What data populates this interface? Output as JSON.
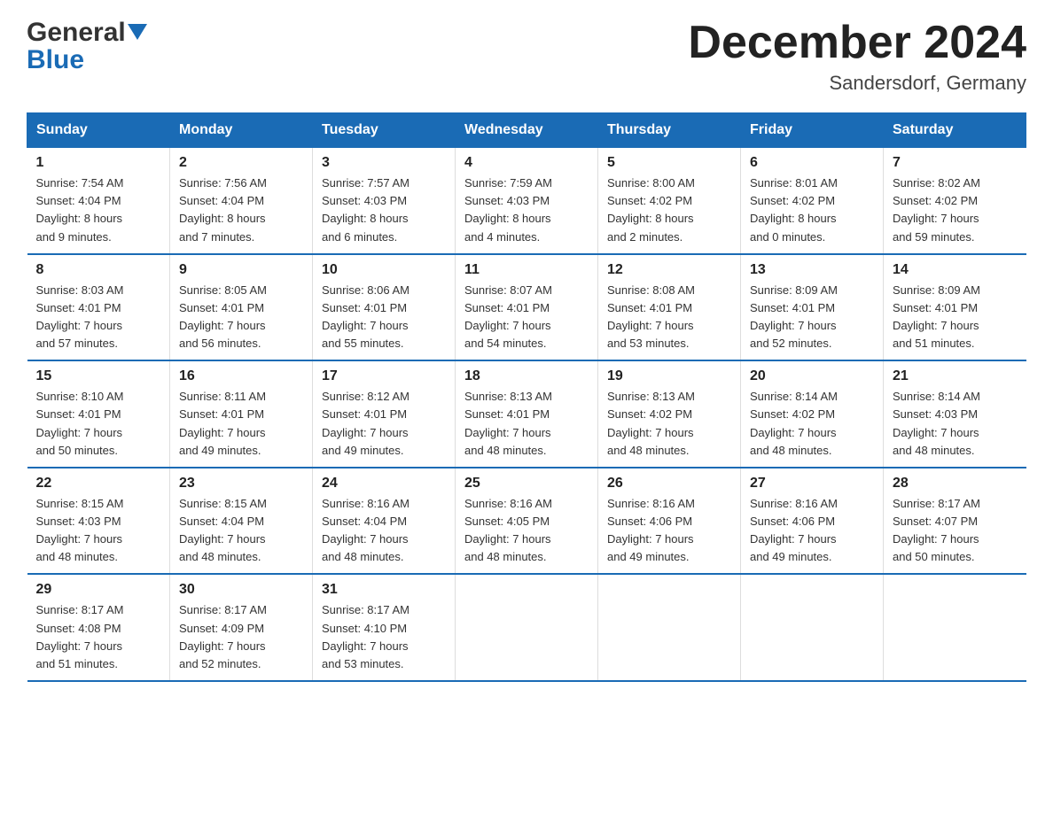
{
  "header": {
    "logo_general": "General",
    "logo_blue": "Blue",
    "title": "December 2024",
    "location": "Sandersdorf, Germany"
  },
  "days_of_week": [
    "Sunday",
    "Monday",
    "Tuesday",
    "Wednesday",
    "Thursday",
    "Friday",
    "Saturday"
  ],
  "weeks": [
    [
      {
        "day": "1",
        "sunrise": "Sunrise: 7:54 AM",
        "sunset": "Sunset: 4:04 PM",
        "daylight": "Daylight: 8 hours",
        "daylight2": "and 9 minutes."
      },
      {
        "day": "2",
        "sunrise": "Sunrise: 7:56 AM",
        "sunset": "Sunset: 4:04 PM",
        "daylight": "Daylight: 8 hours",
        "daylight2": "and 7 minutes."
      },
      {
        "day": "3",
        "sunrise": "Sunrise: 7:57 AM",
        "sunset": "Sunset: 4:03 PM",
        "daylight": "Daylight: 8 hours",
        "daylight2": "and 6 minutes."
      },
      {
        "day": "4",
        "sunrise": "Sunrise: 7:59 AM",
        "sunset": "Sunset: 4:03 PM",
        "daylight": "Daylight: 8 hours",
        "daylight2": "and 4 minutes."
      },
      {
        "day": "5",
        "sunrise": "Sunrise: 8:00 AM",
        "sunset": "Sunset: 4:02 PM",
        "daylight": "Daylight: 8 hours",
        "daylight2": "and 2 minutes."
      },
      {
        "day": "6",
        "sunrise": "Sunrise: 8:01 AM",
        "sunset": "Sunset: 4:02 PM",
        "daylight": "Daylight: 8 hours",
        "daylight2": "and 0 minutes."
      },
      {
        "day": "7",
        "sunrise": "Sunrise: 8:02 AM",
        "sunset": "Sunset: 4:02 PM",
        "daylight": "Daylight: 7 hours",
        "daylight2": "and 59 minutes."
      }
    ],
    [
      {
        "day": "8",
        "sunrise": "Sunrise: 8:03 AM",
        "sunset": "Sunset: 4:01 PM",
        "daylight": "Daylight: 7 hours",
        "daylight2": "and 57 minutes."
      },
      {
        "day": "9",
        "sunrise": "Sunrise: 8:05 AM",
        "sunset": "Sunset: 4:01 PM",
        "daylight": "Daylight: 7 hours",
        "daylight2": "and 56 minutes."
      },
      {
        "day": "10",
        "sunrise": "Sunrise: 8:06 AM",
        "sunset": "Sunset: 4:01 PM",
        "daylight": "Daylight: 7 hours",
        "daylight2": "and 55 minutes."
      },
      {
        "day": "11",
        "sunrise": "Sunrise: 8:07 AM",
        "sunset": "Sunset: 4:01 PM",
        "daylight": "Daylight: 7 hours",
        "daylight2": "and 54 minutes."
      },
      {
        "day": "12",
        "sunrise": "Sunrise: 8:08 AM",
        "sunset": "Sunset: 4:01 PM",
        "daylight": "Daylight: 7 hours",
        "daylight2": "and 53 minutes."
      },
      {
        "day": "13",
        "sunrise": "Sunrise: 8:09 AM",
        "sunset": "Sunset: 4:01 PM",
        "daylight": "Daylight: 7 hours",
        "daylight2": "and 52 minutes."
      },
      {
        "day": "14",
        "sunrise": "Sunrise: 8:09 AM",
        "sunset": "Sunset: 4:01 PM",
        "daylight": "Daylight: 7 hours",
        "daylight2": "and 51 minutes."
      }
    ],
    [
      {
        "day": "15",
        "sunrise": "Sunrise: 8:10 AM",
        "sunset": "Sunset: 4:01 PM",
        "daylight": "Daylight: 7 hours",
        "daylight2": "and 50 minutes."
      },
      {
        "day": "16",
        "sunrise": "Sunrise: 8:11 AM",
        "sunset": "Sunset: 4:01 PM",
        "daylight": "Daylight: 7 hours",
        "daylight2": "and 49 minutes."
      },
      {
        "day": "17",
        "sunrise": "Sunrise: 8:12 AM",
        "sunset": "Sunset: 4:01 PM",
        "daylight": "Daylight: 7 hours",
        "daylight2": "and 49 minutes."
      },
      {
        "day": "18",
        "sunrise": "Sunrise: 8:13 AM",
        "sunset": "Sunset: 4:01 PM",
        "daylight": "Daylight: 7 hours",
        "daylight2": "and 48 minutes."
      },
      {
        "day": "19",
        "sunrise": "Sunrise: 8:13 AM",
        "sunset": "Sunset: 4:02 PM",
        "daylight": "Daylight: 7 hours",
        "daylight2": "and 48 minutes."
      },
      {
        "day": "20",
        "sunrise": "Sunrise: 8:14 AM",
        "sunset": "Sunset: 4:02 PM",
        "daylight": "Daylight: 7 hours",
        "daylight2": "and 48 minutes."
      },
      {
        "day": "21",
        "sunrise": "Sunrise: 8:14 AM",
        "sunset": "Sunset: 4:03 PM",
        "daylight": "Daylight: 7 hours",
        "daylight2": "and 48 minutes."
      }
    ],
    [
      {
        "day": "22",
        "sunrise": "Sunrise: 8:15 AM",
        "sunset": "Sunset: 4:03 PM",
        "daylight": "Daylight: 7 hours",
        "daylight2": "and 48 minutes."
      },
      {
        "day": "23",
        "sunrise": "Sunrise: 8:15 AM",
        "sunset": "Sunset: 4:04 PM",
        "daylight": "Daylight: 7 hours",
        "daylight2": "and 48 minutes."
      },
      {
        "day": "24",
        "sunrise": "Sunrise: 8:16 AM",
        "sunset": "Sunset: 4:04 PM",
        "daylight": "Daylight: 7 hours",
        "daylight2": "and 48 minutes."
      },
      {
        "day": "25",
        "sunrise": "Sunrise: 8:16 AM",
        "sunset": "Sunset: 4:05 PM",
        "daylight": "Daylight: 7 hours",
        "daylight2": "and 48 minutes."
      },
      {
        "day": "26",
        "sunrise": "Sunrise: 8:16 AM",
        "sunset": "Sunset: 4:06 PM",
        "daylight": "Daylight: 7 hours",
        "daylight2": "and 49 minutes."
      },
      {
        "day": "27",
        "sunrise": "Sunrise: 8:16 AM",
        "sunset": "Sunset: 4:06 PM",
        "daylight": "Daylight: 7 hours",
        "daylight2": "and 49 minutes."
      },
      {
        "day": "28",
        "sunrise": "Sunrise: 8:17 AM",
        "sunset": "Sunset: 4:07 PM",
        "daylight": "Daylight: 7 hours",
        "daylight2": "and 50 minutes."
      }
    ],
    [
      {
        "day": "29",
        "sunrise": "Sunrise: 8:17 AM",
        "sunset": "Sunset: 4:08 PM",
        "daylight": "Daylight: 7 hours",
        "daylight2": "and 51 minutes."
      },
      {
        "day": "30",
        "sunrise": "Sunrise: 8:17 AM",
        "sunset": "Sunset: 4:09 PM",
        "daylight": "Daylight: 7 hours",
        "daylight2": "and 52 minutes."
      },
      {
        "day": "31",
        "sunrise": "Sunrise: 8:17 AM",
        "sunset": "Sunset: 4:10 PM",
        "daylight": "Daylight: 7 hours",
        "daylight2": "and 53 minutes."
      },
      null,
      null,
      null,
      null
    ]
  ]
}
